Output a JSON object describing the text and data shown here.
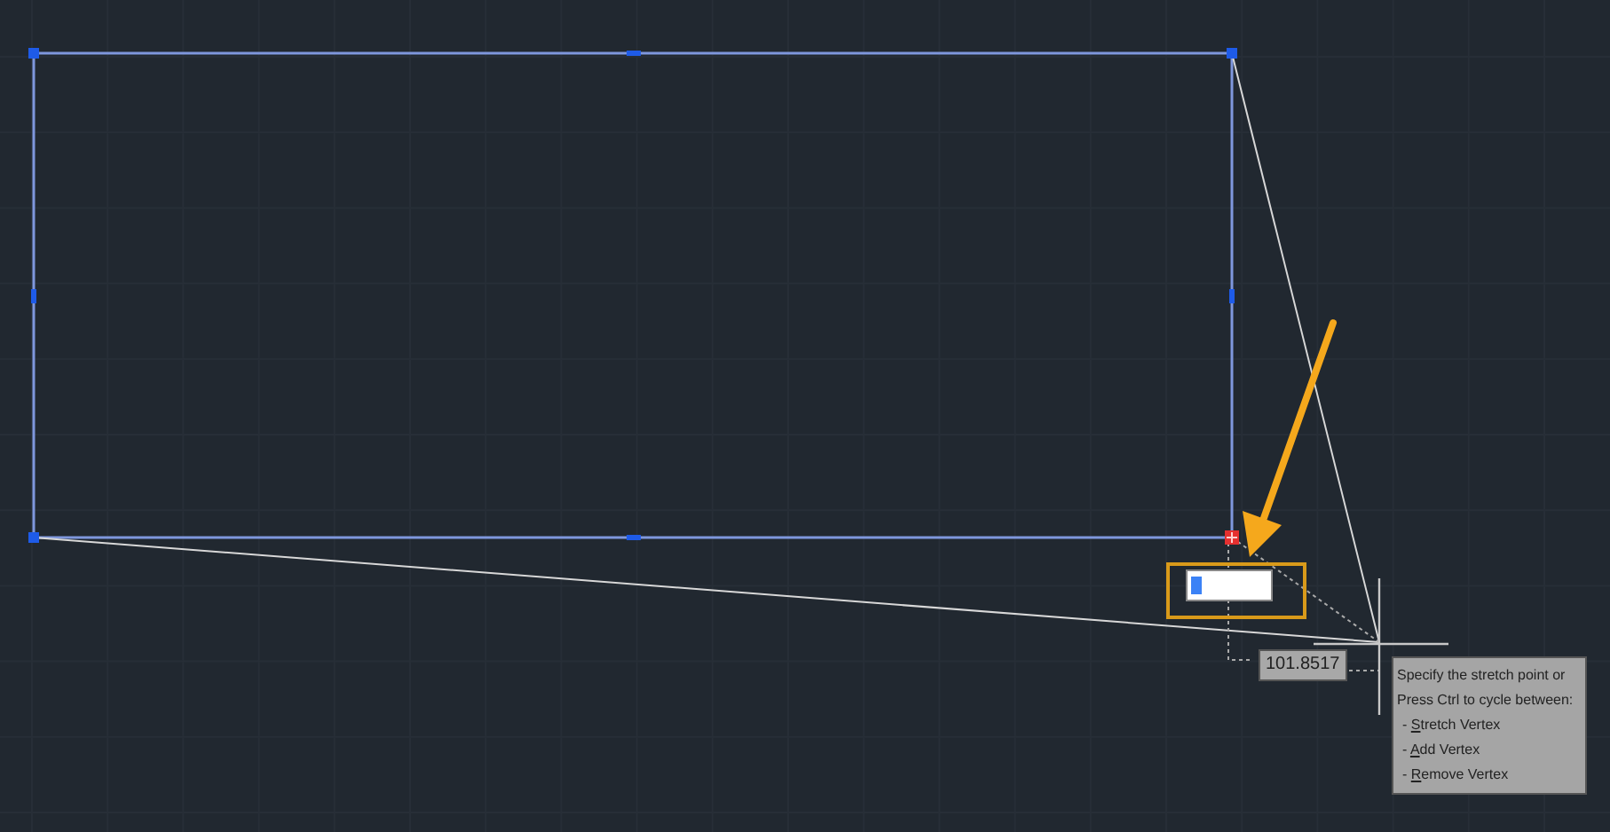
{
  "grips": [
    {
      "selected": false
    },
    {
      "selected": false
    },
    {
      "selected": false
    },
    {
      "selected": true
    },
    {
      "selected": false
    },
    {
      "selected": false
    },
    {
      "selected": false
    },
    {
      "selected": false
    }
  ],
  "dimension": {
    "value": "101.8517"
  },
  "tooltip": {
    "lines": [
      "Specify the stretch point or",
      "Press Ctrl to cycle between:"
    ],
    "options": [
      {
        "before": "- ",
        "mnemonic": "S",
        "after": "tretch Vertex"
      },
      {
        "before": "- ",
        "mnemonic": "A",
        "after": "dd Vertex"
      },
      {
        "before": "- ",
        "mnemonic": "R",
        "after": "emove Vertex"
      }
    ]
  }
}
